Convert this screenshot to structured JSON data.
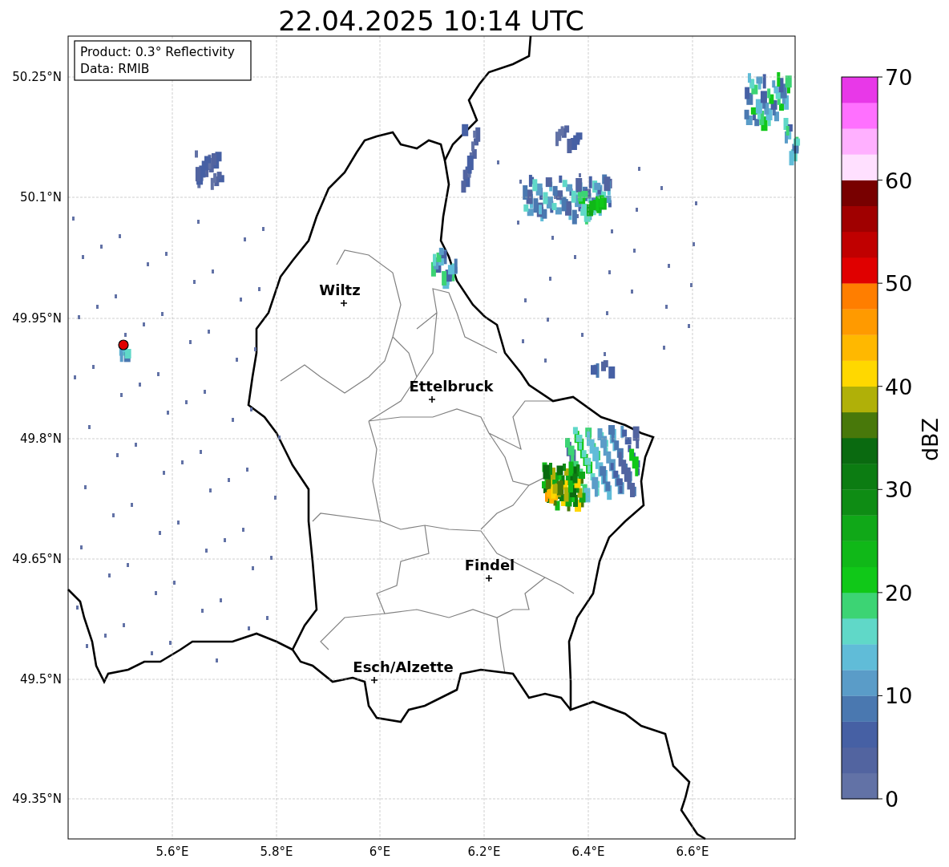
{
  "title": "22.04.2025 10:14 UTC",
  "info_box": {
    "lines": [
      "Product: 0.3° Reflectivity",
      "Data: RMIB"
    ]
  },
  "lat_ticks": [
    "50.25°N",
    "50.1°N",
    "49.95°N",
    "49.8°N",
    "49.65°N",
    "49.5°N",
    "49.35°N"
  ],
  "lon_ticks": [
    "5.6°E",
    "5.8°E",
    "6°E",
    "6.2°E",
    "6.4°E",
    "6.6°E"
  ],
  "cities": [
    {
      "name": "Wiltz"
    },
    {
      "name": "Ettelbruck"
    },
    {
      "name": "Findel"
    },
    {
      "name": "Esch/Alzette"
    }
  ],
  "colorbar": {
    "label": "dBZ",
    "ticks": [
      "70",
      "60",
      "50",
      "40",
      "30",
      "20",
      "10",
      "0"
    ],
    "bins": [
      {
        "color": "#6272a6"
      },
      {
        "color": "#5264a0"
      },
      {
        "color": "#4660a4"
      },
      {
        "color": "#4a78b0"
      },
      {
        "color": "#5a9cc8"
      },
      {
        "color": "#60bcd8"
      },
      {
        "color": "#60d8c8"
      },
      {
        "color": "#3cd474"
      },
      {
        "color": "#10c818"
      },
      {
        "color": "#10b818"
      },
      {
        "color": "#10a818"
      },
      {
        "color": "#0e8c14"
      },
      {
        "color": "#0c7c12"
      },
      {
        "color": "#0a6a10"
      },
      {
        "color": "#48780a"
      },
      {
        "color": "#b0b008"
      },
      {
        "color": "#ffd800"
      },
      {
        "color": "#ffb800"
      },
      {
        "color": "#ff9a00"
      },
      {
        "color": "#ff7e00"
      },
      {
        "color": "#e00000"
      },
      {
        "color": "#c00000"
      },
      {
        "color": "#a00000"
      },
      {
        "color": "#780000"
      },
      {
        "color": "#ffe0ff"
      },
      {
        "color": "#ffb0ff"
      },
      {
        "color": "#ff70ff"
      },
      {
        "color": "#e838e8"
      }
    ]
  }
}
